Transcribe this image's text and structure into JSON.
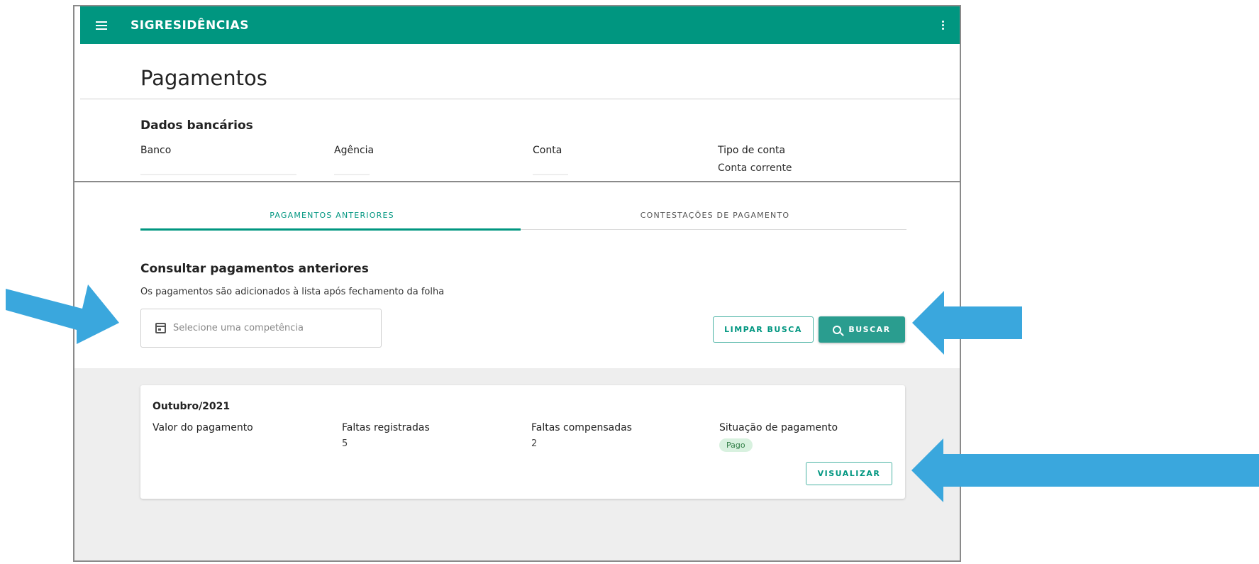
{
  "theme": {
    "brand": "#009680",
    "brand_button": "#2a9d8f",
    "arrow_color": "#3aa7dd"
  },
  "header": {
    "app_title": "SIGRESIDÊNCIAS",
    "menu_icon": "hamburger-icon",
    "more_icon": "kebab-icon"
  },
  "page": {
    "title": "Pagamentos"
  },
  "bank": {
    "heading": "Dados bancários",
    "fields": [
      {
        "label": "Banco",
        "value": ""
      },
      {
        "label": "Agência",
        "value": ""
      },
      {
        "label": "Conta",
        "value": ""
      },
      {
        "label": "Tipo de conta",
        "value": "Conta corrente"
      }
    ]
  },
  "tabs": [
    {
      "label": "PAGAMENTOS ANTERIORES",
      "active": true
    },
    {
      "label": "CONTESTAÇÕES DE PAGAMENTO",
      "active": false
    }
  ],
  "search": {
    "heading": "Consultar pagamentos anteriores",
    "subtitle": "Os pagamentos são adicionados à lista após fechamento da folha",
    "placeholder": "Selecione uma competência",
    "input_icon": "calendar-icon",
    "clear_label": "LIMPAR BUSCA",
    "search_label": "BUSCAR",
    "search_icon": "search-icon"
  },
  "payments": [
    {
      "period": "Outubro/2021",
      "labels": {
        "value": "Valor do pagamento",
        "absences": "Faltas registradas",
        "compensated": "Faltas compensadas",
        "status": "Situação de pagamento"
      },
      "value": "",
      "absences": "5",
      "compensated": "2",
      "status": "Pago",
      "view_label": "VISUALIZAR"
    }
  ]
}
